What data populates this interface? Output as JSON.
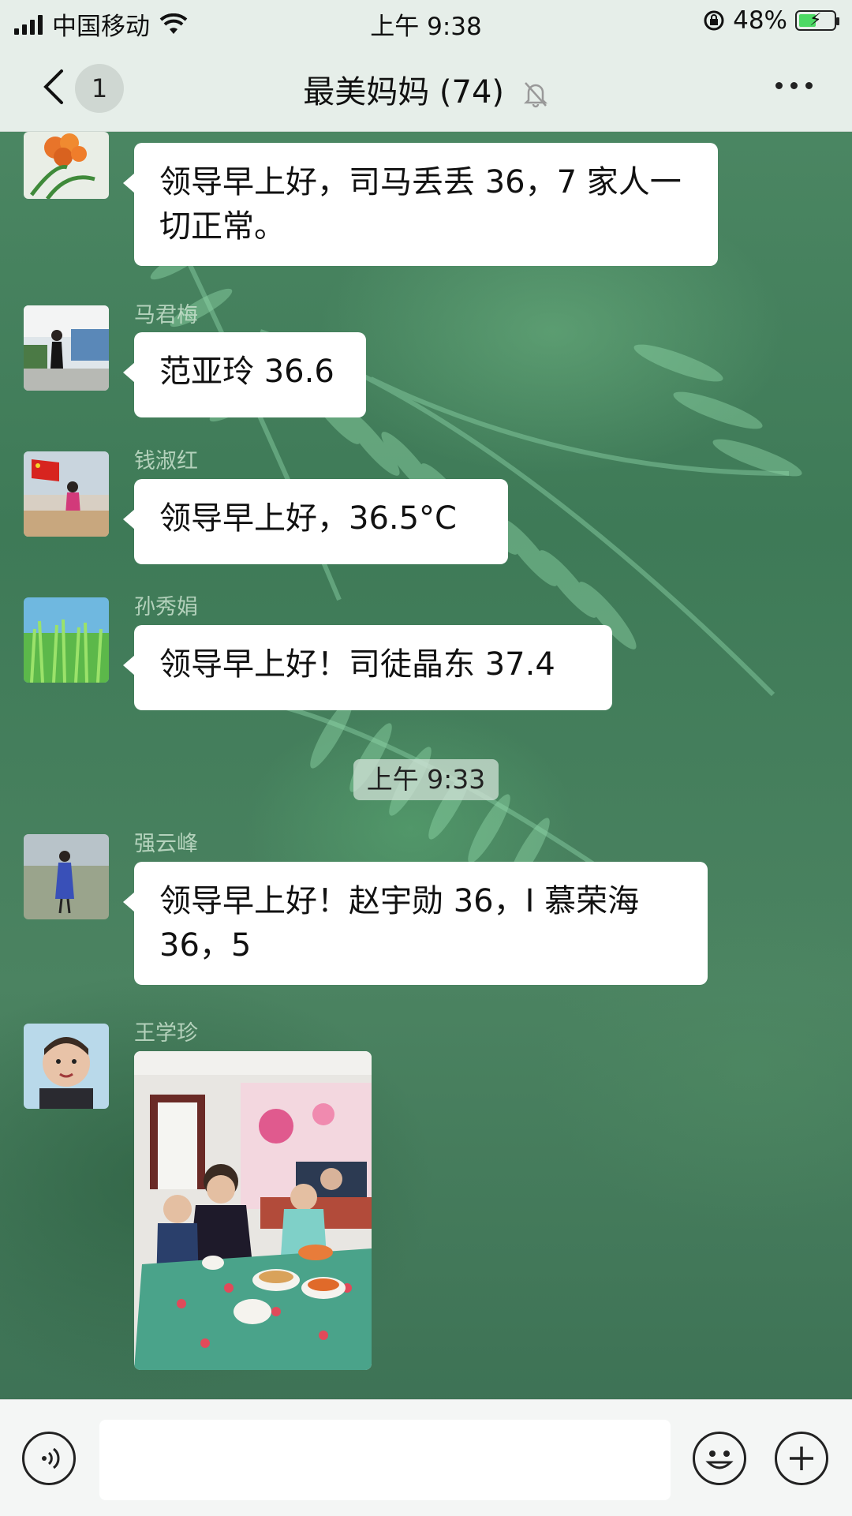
{
  "status_bar": {
    "carrier": "中国移动",
    "time": "上午 9:38",
    "battery": "48%",
    "battery_level": 0.48
  },
  "nav": {
    "unread_count": "1",
    "title": "最美妈妈 (74)"
  },
  "messages": [
    {
      "sender": "",
      "text": "领导早上好，司马丢丢 36，7 家人一切正常。"
    },
    {
      "sender": "马君梅",
      "text": "范亚玲 36.6"
    },
    {
      "sender": "钱淑红",
      "text": "领导早上好，36.5°C"
    },
    {
      "sender": "孙秀娟",
      "text": "领导早上好！司徒晶东 37.4"
    },
    {
      "sender": "强云峰",
      "text": "领导早上好！赵宇勋 36，I 慕荣海 36，5"
    },
    {
      "sender": "王学珍",
      "text": ""
    }
  ],
  "timestamp": "上午 9:33",
  "icons": {
    "back": "chevron-left-icon",
    "mute": "bell-slash-icon",
    "more": "ellipsis-icon",
    "voice": "voice-icon",
    "emoji": "emoji-icon",
    "add": "plus-circle-icon"
  },
  "colors": {
    "bar_bg": "#e6eee9",
    "bubble_bg": "#ffffff",
    "battery_green": "#4cd964"
  }
}
